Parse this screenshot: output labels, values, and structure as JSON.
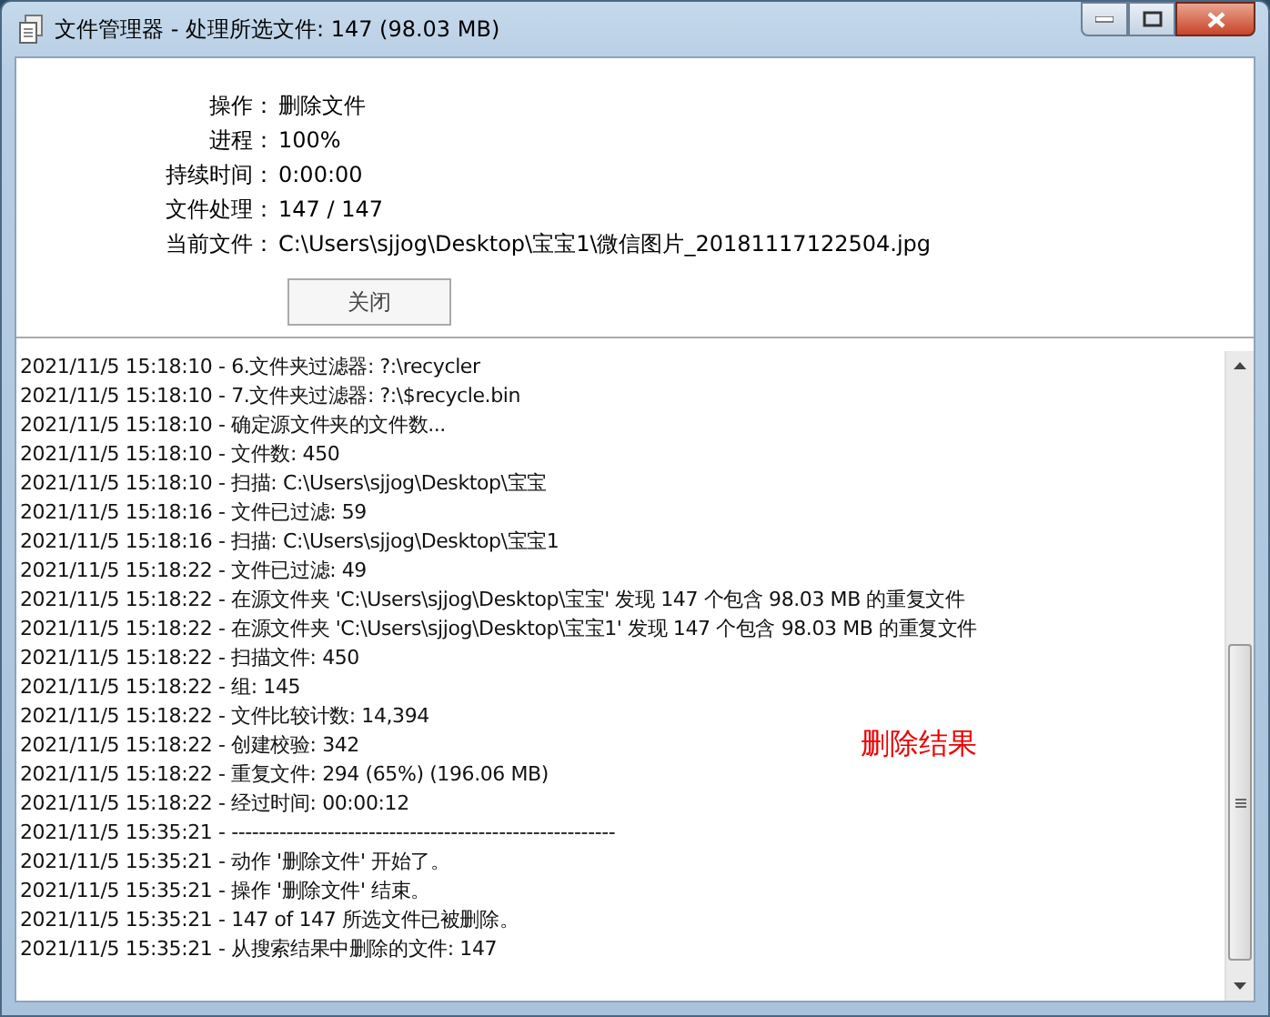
{
  "window": {
    "title": "文件管理器 - 处理所选文件: 147 (98.03 MB)"
  },
  "info": [
    {
      "label": "操作：",
      "value": "删除文件"
    },
    {
      "label": "进程：",
      "value": "100%"
    },
    {
      "label": "持续时间：",
      "value": "0:00:00"
    },
    {
      "label": "文件处理：",
      "value": "147 / 147"
    },
    {
      "label": "当前文件：",
      "value": "C:\\Users\\sjjog\\Desktop\\宝宝1\\微信图片_20181117122504.jpg"
    }
  ],
  "close_button": "关闭",
  "log": [
    "2021/11/5 15:18:10 - 6.文件夹过滤器: ?:\\recycler",
    "2021/11/5 15:18:10 - 7.文件夹过滤器: ?:\\$recycle.bin",
    "2021/11/5 15:18:10 - 确定源文件夹的文件数...",
    "2021/11/5 15:18:10 - 文件数: 450",
    "2021/11/5 15:18:10 - 扫描: C:\\Users\\sjjog\\Desktop\\宝宝",
    "2021/11/5 15:18:16 - 文件已过滤: 59",
    "2021/11/5 15:18:16 - 扫描: C:\\Users\\sjjog\\Desktop\\宝宝1",
    "2021/11/5 15:18:22 - 文件已过滤: 49",
    "2021/11/5 15:18:22 - 在源文件夹 'C:\\Users\\sjjog\\Desktop\\宝宝' 发现 147 个包含 98.03 MB 的重复文件",
    "2021/11/5 15:18:22 - 在源文件夹 'C:\\Users\\sjjog\\Desktop\\宝宝1' 发现 147 个包含 98.03 MB 的重复文件",
    "2021/11/5 15:18:22 - 扫描文件: 450",
    "2021/11/5 15:18:22 - 组: 145",
    "2021/11/5 15:18:22 - 文件比较计数: 14,394",
    "2021/11/5 15:18:22 - 创建校验: 342",
    "2021/11/5 15:18:22 - 重复文件: 294 (65%) (196.06 MB)",
    "2021/11/5 15:18:22 - 经过时间: 00:00:12",
    "2021/11/5 15:35:21 - --------------------------------------------------------",
    "2021/11/5 15:35:21 - 动作 '删除文件' 开始了。",
    "2021/11/5 15:35:21 - 操作 '删除文件' 结束。",
    "2021/11/5 15:35:21 - 147 of 147 所选文件已被删除。",
    "2021/11/5 15:35:21 - 从搜索结果中删除的文件: 147"
  ],
  "annotation": "删除结果"
}
